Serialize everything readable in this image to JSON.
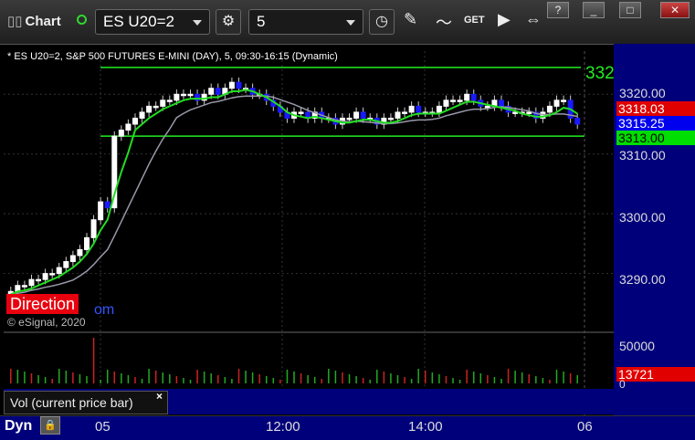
{
  "toolbar": {
    "title": "Chart",
    "symbol": "ES U20=2",
    "interval": "5",
    "icons": [
      "settings-gear-icon",
      "clock-icon",
      "pencil-draw-icon",
      "study-wave-icon",
      "get-icon",
      "play-icon",
      "arrows-icon",
      "help-icon",
      "minimize-icon",
      "restore-icon",
      "close-icon"
    ],
    "get_label": "GET"
  },
  "window": {
    "help": "?",
    "min": "_",
    "restore": "□",
    "close": "✕"
  },
  "info_line": "* ES U20=2, S&P 500 FUTURES E-MINI (DAY), 5, 09:30-16:15 (Dynamic)",
  "copyright": "© eSignal, 2020",
  "direction": {
    "label": "Direction",
    "tail": "om"
  },
  "price_axis": {
    "ticks": [
      "3320.00",
      "3310.00",
      "3300.00",
      "3290.00"
    ],
    "tags": [
      {
        "text": "3318.03",
        "bg": "#e00000",
        "fg": "#ffffff"
      },
      {
        "text": "3315.25",
        "bg": "#0000ee",
        "fg": "#ffffff"
      },
      {
        "text": "3313.00",
        "bg": "#00dd00",
        "fg": "#000000"
      }
    ],
    "top_level": "332"
  },
  "volume": {
    "label": "Vol (current price bar)",
    "close": "×",
    "tick": "50000",
    "tag": "13721",
    "zero": "0"
  },
  "time_axis": {
    "labels": [
      "05",
      "12:00",
      "14:00",
      "06"
    ]
  },
  "bottom": {
    "dyn": "Dyn",
    "lock_icon": "lock-icon"
  },
  "colors": {
    "up": "#ffffff",
    "down": "#1a1aff",
    "ma_green": "#22dd22",
    "ma_red": "#ff2222",
    "ma_gray": "#9999aa",
    "level": "#22ee22",
    "vol_green": "#22aa22",
    "vol_red": "#cc2222"
  },
  "chart_data": {
    "type": "candlestick",
    "ylim": [
      3282,
      3326
    ],
    "levels": [
      3324.5,
      3313.0
    ],
    "candles_close": [
      3287,
      3288,
      3288,
      3289,
      3289,
      3290,
      3290,
      3291,
      3292,
      3293,
      3294,
      3296,
      3299,
      3302,
      3301,
      3313,
      3314,
      3315,
      3316,
      3317,
      3318,
      3318,
      3319,
      3319,
      3320,
      3320,
      3320,
      3319,
      3320,
      3321,
      3320,
      3321,
      3322,
      3321,
      3321,
      3320,
      3320,
      3319,
      3318,
      3317,
      3316,
      3317,
      3317,
      3316,
      3317,
      3316,
      3316,
      3315,
      3316,
      3316,
      3317,
      3316,
      3316,
      3315,
      3316,
      3316,
      3317,
      3317,
      3318,
      3317,
      3317,
      3317,
      3318,
      3319,
      3319,
      3319,
      3320,
      3319,
      3318,
      3318,
      3319,
      3318,
      3317,
      3317,
      3317,
      3317,
      3316,
      3317,
      3318,
      3319,
      3319,
      3316,
      3315
    ]
  }
}
